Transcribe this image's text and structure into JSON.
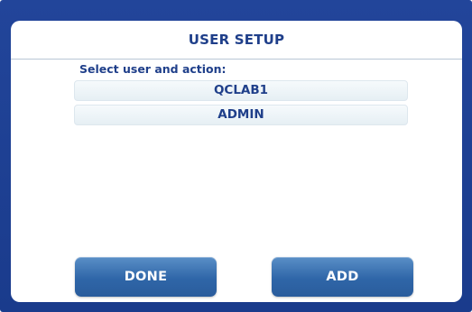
{
  "header": {
    "title": "USER SETUP"
  },
  "main": {
    "prompt": "Select user and action:",
    "users": [
      {
        "label": "QCLAB1"
      },
      {
        "label": "ADMIN"
      }
    ]
  },
  "footer": {
    "done_label": "DONE",
    "add_label": "ADD"
  },
  "colors": {
    "frame": "#1a3b8c",
    "text_accent": "#1f3f8a",
    "button": "#2f66a8"
  }
}
